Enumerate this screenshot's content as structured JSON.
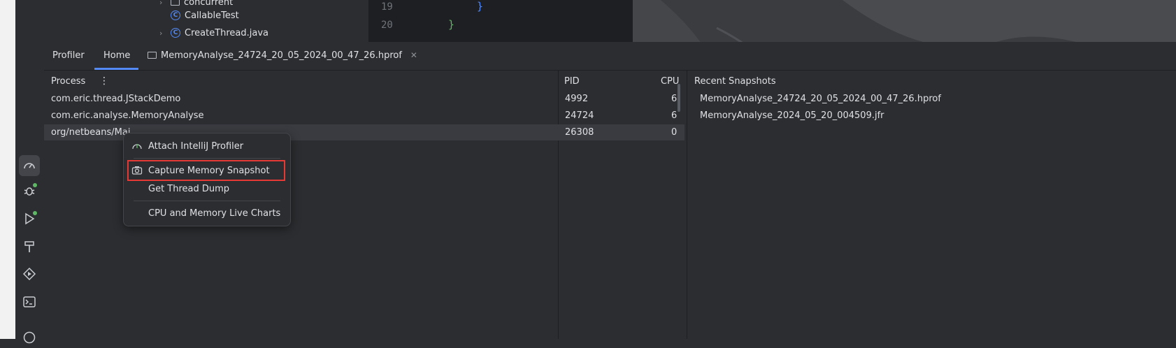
{
  "project_tree": {
    "items": [
      {
        "label": "concurrent",
        "kind": "package"
      },
      {
        "label": "CallableTest",
        "kind": "class"
      },
      {
        "label": "CreateThread.java",
        "kind": "class"
      }
    ]
  },
  "editor": {
    "lines": [
      {
        "number": "19",
        "text": "}"
      },
      {
        "number": "20",
        "text": "}"
      }
    ]
  },
  "profiler": {
    "title": "Profiler",
    "tabs": [
      {
        "label": "Home",
        "active": true
      },
      {
        "label": "MemoryAnalyse_24724_20_05_2024_00_47_26.hprof",
        "closable": true
      }
    ],
    "process_table": {
      "headers": {
        "process": "Process",
        "pid": "PID",
        "cpu": "CPU"
      },
      "rows": [
        {
          "process": "com.eric.thread.JStackDemo",
          "pid": "4992",
          "cpu": "6"
        },
        {
          "process": "com.eric.analyse.MemoryAnalyse",
          "pid": "24724",
          "cpu": "6"
        },
        {
          "process": "org/netbeans/Mai",
          "pid": "26308",
          "cpu": "0",
          "selected": true
        }
      ]
    },
    "recent_snapshots": {
      "header": "Recent Snapshots",
      "items": [
        "MemoryAnalyse_24724_20_05_2024_00_47_26.hprof",
        "MemoryAnalyse_2024_05_20_004509.jfr"
      ]
    }
  },
  "context_menu": {
    "items": [
      {
        "label": "Attach IntelliJ Profiler",
        "icon": "profiler-attach-icon"
      },
      {
        "label": "Capture Memory Snapshot",
        "icon": "camera-icon",
        "highlighted": true
      },
      {
        "label": "Get Thread Dump"
      },
      {
        "label": "CPU and Memory Live Charts"
      }
    ]
  },
  "colors": {
    "accent": "#548af7",
    "highlight_border": "#e53935",
    "status_green": "#5fb865"
  }
}
